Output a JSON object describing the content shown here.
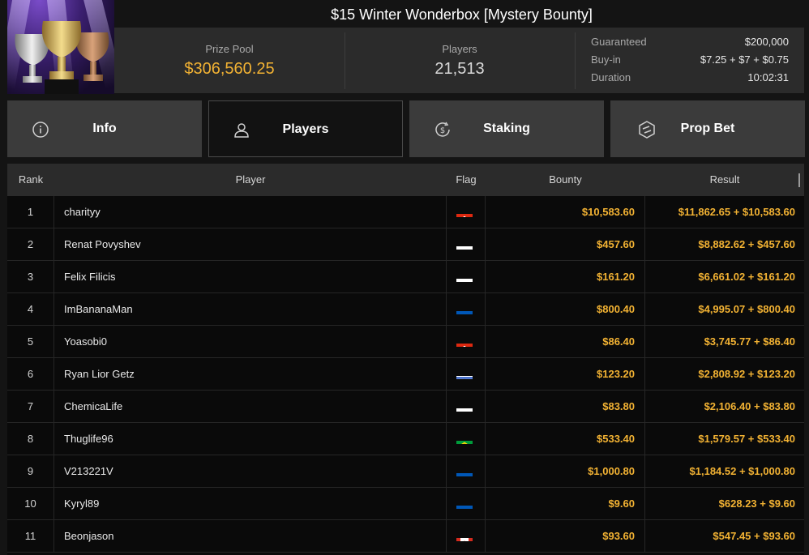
{
  "tournament": {
    "title": "$15 Winter Wonderbox [Mystery Bounty]",
    "prize_pool_label": "Prize Pool",
    "prize_pool": "$306,560.25",
    "players_label": "Players",
    "players": "21,513",
    "guaranteed_label": "Guaranteed",
    "guaranteed": "$200,000",
    "buyin_label": "Buy-in",
    "buyin": "$7.25 + $7 + $0.75",
    "duration_label": "Duration",
    "duration": "10:02:31"
  },
  "tabs": [
    {
      "label": "Info",
      "icon": "info-icon",
      "active": false
    },
    {
      "label": "Players",
      "icon": "user-icon",
      "active": true
    },
    {
      "label": "Staking",
      "icon": "dollar-coin-icon",
      "active": false
    },
    {
      "label": "Prop Bet",
      "icon": "prop-bet-icon",
      "active": false
    }
  ],
  "table": {
    "headers": {
      "rank": "Rank",
      "player": "Player",
      "flag": "Flag",
      "bounty": "Bounty",
      "result": "Result"
    },
    "rows": [
      {
        "rank": "1",
        "player": "charityy",
        "flag": "hong-kong",
        "bounty": "$10,583.60",
        "result": "$11,862.65 + $10,583.60"
      },
      {
        "rank": "2",
        "player": "Renat Povyshev",
        "flag": "russia",
        "bounty": "$457.60",
        "result": "$8,882.62 + $457.60"
      },
      {
        "rank": "3",
        "player": "Felix Filicis",
        "flag": "russia",
        "bounty": "$161.20",
        "result": "$6,661.02 + $161.20"
      },
      {
        "rank": "4",
        "player": "ImBananaMan",
        "flag": "ukraine",
        "bounty": "$800.40",
        "result": "$4,995.07 + $800.40"
      },
      {
        "rank": "5",
        "player": "Yoasobi0",
        "flag": "hong-kong",
        "bounty": "$86.40",
        "result": "$3,745.77 + $86.40"
      },
      {
        "rank": "6",
        "player": "Ryan Lior Getz",
        "flag": "israel",
        "bounty": "$123.20",
        "result": "$2,808.92 + $123.20"
      },
      {
        "rank": "7",
        "player": "ChemicaLife",
        "flag": "russia",
        "bounty": "$83.80",
        "result": "$2,106.40 + $83.80"
      },
      {
        "rank": "8",
        "player": "Thuglife96",
        "flag": "brazil",
        "bounty": "$533.40",
        "result": "$1,579.57 + $533.40"
      },
      {
        "rank": "9",
        "player": "V213221V",
        "flag": "ukraine",
        "bounty": "$1,000.80",
        "result": "$1,184.52 + $1,000.80"
      },
      {
        "rank": "10",
        "player": "Kyryl89",
        "flag": "ukraine",
        "bounty": "$9.60",
        "result": "$628.23 + $9.60"
      },
      {
        "rank": "11",
        "player": "Beonjason",
        "flag": "canada",
        "bounty": "$93.60",
        "result": "$547.45 + $93.60"
      }
    ]
  },
  "colors": {
    "accent": "#f2b233",
    "panel": "#2b2b2b",
    "tab": "#3b3b3b"
  }
}
